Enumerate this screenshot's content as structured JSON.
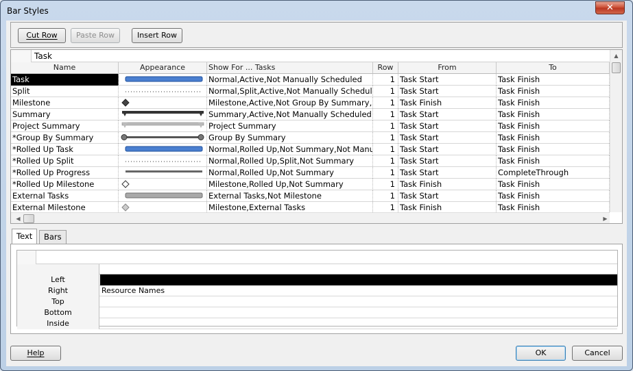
{
  "window": {
    "title": "Bar Styles",
    "close_glyph": "✕"
  },
  "toolbar": {
    "cut_row": "Cut Row",
    "paste_row": "Paste Row",
    "insert_row": "Insert Row"
  },
  "table": {
    "entry_value": "Task",
    "columns": [
      "Name",
      "Appearance",
      "Show For ... Tasks",
      "Row",
      "From",
      "To"
    ],
    "rows": [
      {
        "name": "Task",
        "appearance": "bar-blue-icon",
        "show_for": "Normal,Active,Not Manually Scheduled",
        "row": "1",
        "from": "Task Start",
        "to": "Task Finish",
        "selected": true
      },
      {
        "name": "Split",
        "appearance": "dotted-line-icon",
        "show_for": "Normal,Split,Active,Not Manually Schedule",
        "row": "1",
        "from": "Task Start",
        "to": "Task Finish"
      },
      {
        "name": "Milestone",
        "appearance": "diamond-dark-icon",
        "show_for": "Milestone,Active,Not Group By Summary,Nc",
        "row": "1",
        "from": "Task Finish",
        "to": "Task Finish"
      },
      {
        "name": "Summary",
        "appearance": "summary-bracket-icon",
        "show_for": "Summary,Active,Not Manually Scheduled",
        "row": "1",
        "from": "Task Start",
        "to": "Task Finish"
      },
      {
        "name": "Project Summary",
        "appearance": "project-summary-bracket-icon",
        "show_for": "Project Summary",
        "row": "1",
        "from": "Task Start",
        "to": "Task Finish"
      },
      {
        "name": "*Group By Summary",
        "appearance": "group-summary-bar-icon",
        "show_for": "Group By Summary",
        "row": "1",
        "from": "Task Start",
        "to": "Task Finish"
      },
      {
        "name": "*Rolled Up Task",
        "appearance": "bar-blue-icon",
        "show_for": "Normal,Rolled Up,Not Summary,Not Manua",
        "row": "1",
        "from": "Task Start",
        "to": "Task Finish"
      },
      {
        "name": "*Rolled Up Split",
        "appearance": "dotted-line-icon",
        "show_for": "Normal,Rolled Up,Split,Not Summary",
        "row": "1",
        "from": "Task Start",
        "to": "Task Finish"
      },
      {
        "name": "*Rolled Up Progress",
        "appearance": "progress-line-icon",
        "show_for": "Normal,Rolled Up,Not Summary",
        "row": "1",
        "from": "Task Start",
        "to": "CompleteThrough"
      },
      {
        "name": "*Rolled Up Milestone",
        "appearance": "diamond-outline-icon",
        "show_for": "Milestone,Rolled Up,Not Summary",
        "row": "1",
        "from": "Task Finish",
        "to": "Task Finish"
      },
      {
        "name": "External Tasks",
        "appearance": "bar-gray-icon",
        "show_for": "External Tasks,Not Milestone",
        "row": "1",
        "from": "Task Start",
        "to": "Task Finish"
      },
      {
        "name": "External Milestone",
        "appearance": "diamond-gray-icon",
        "show_for": "Milestone,External Tasks",
        "row": "1",
        "from": "Task Finish",
        "to": "Task Finish"
      }
    ]
  },
  "tabs": [
    {
      "label": "Text",
      "active": true
    },
    {
      "label": "Bars",
      "active": false
    }
  ],
  "text_grid": {
    "rows": [
      {
        "label": "Left",
        "value": "",
        "filled": true
      },
      {
        "label": "Right",
        "value": "Resource Names"
      },
      {
        "label": "Top",
        "value": ""
      },
      {
        "label": "Bottom",
        "value": ""
      },
      {
        "label": "Inside",
        "value": ""
      }
    ]
  },
  "buttons": {
    "help": "Help",
    "ok": "OK",
    "cancel": "Cancel"
  },
  "colors": {
    "bar_blue": "#4a7fd0",
    "selected_bg": "#000000"
  }
}
